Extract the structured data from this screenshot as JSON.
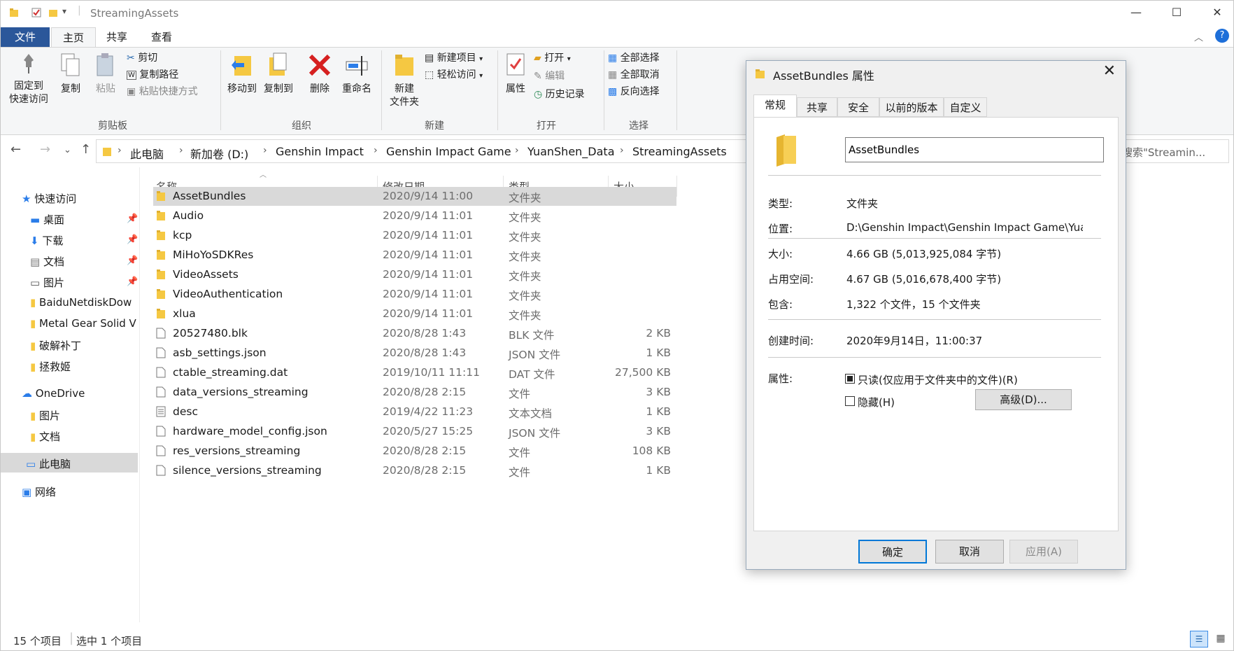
{
  "window": {
    "title": "StreamingAssets",
    "controls": {
      "minimize": "—",
      "maximize": "☐",
      "close": "✕"
    }
  },
  "ribbon_tabs": {
    "file": "文件",
    "home": "主页",
    "share": "共享",
    "view": "查看"
  },
  "ribbon": {
    "clipboard": {
      "pin_l1": "固定到",
      "pin_l2": "快速访问",
      "copy": "复制",
      "paste": "粘贴",
      "cut": "剪切",
      "copy_path": "复制路径",
      "paste_shortcut": "粘贴快捷方式",
      "group": "剪贴板"
    },
    "organize": {
      "move_to": "移动到",
      "copy_to": "复制到",
      "delete": "删除",
      "rename": "重命名",
      "group": "组织"
    },
    "new": {
      "new_folder_l1": "新建",
      "new_folder_l2": "文件夹",
      "new_item": "新建项目",
      "easy_access": "轻松访问",
      "group": "新建"
    },
    "open": {
      "properties": "属性",
      "open": "打开",
      "edit": "编辑",
      "history": "历史记录",
      "group": "打开"
    },
    "select": {
      "select_all": "全部选择",
      "select_none": "全部取消",
      "invert": "反向选择",
      "group": "选择"
    }
  },
  "breadcrumb": [
    "此电脑",
    "新加卷 (D:)",
    "Genshin Impact",
    "Genshin Impact Game",
    "YuanShen_Data",
    "StreamingAssets"
  ],
  "search": {
    "placeholder": "搜索\"Streamin..."
  },
  "nav_pane": {
    "quick_access": "快速访问",
    "items": [
      "桌面",
      "下载",
      "文档",
      "图片",
      "BaiduNetdiskDow",
      "Metal Gear Solid V",
      "破解补丁",
      "拯救姬"
    ],
    "onedrive": "OneDrive",
    "onedrive_items": [
      "图片",
      "文档"
    ],
    "this_pc": "此电脑",
    "network": "网络"
  },
  "columns": {
    "name": "名称",
    "date": "修改日期",
    "type": "类型",
    "size": "大小"
  },
  "files": [
    {
      "name": "AssetBundles",
      "date": "2020/9/14 11:00",
      "type": "文件夹",
      "size": "",
      "kind": "folder"
    },
    {
      "name": "Audio",
      "date": "2020/9/14 11:01",
      "type": "文件夹",
      "size": "",
      "kind": "folder"
    },
    {
      "name": "kcp",
      "date": "2020/9/14 11:01",
      "type": "文件夹",
      "size": "",
      "kind": "folder"
    },
    {
      "name": "MiHoYoSDKRes",
      "date": "2020/9/14 11:01",
      "type": "文件夹",
      "size": "",
      "kind": "folder"
    },
    {
      "name": "VideoAssets",
      "date": "2020/9/14 11:01",
      "type": "文件夹",
      "size": "",
      "kind": "folder"
    },
    {
      "name": "VideoAuthentication",
      "date": "2020/9/14 11:01",
      "type": "文件夹",
      "size": "",
      "kind": "folder"
    },
    {
      "name": "xlua",
      "date": "2020/9/14 11:01",
      "type": "文件夹",
      "size": "",
      "kind": "folder"
    },
    {
      "name": "20527480.blk",
      "date": "2020/8/28 1:43",
      "type": "BLK 文件",
      "size": "2 KB",
      "kind": "file"
    },
    {
      "name": "asb_settings.json",
      "date": "2020/8/28 1:43",
      "type": "JSON 文件",
      "size": "1 KB",
      "kind": "file"
    },
    {
      "name": "ctable_streaming.dat",
      "date": "2019/10/11 11:11",
      "type": "DAT 文件",
      "size": "27,500 KB",
      "kind": "file"
    },
    {
      "name": "data_versions_streaming",
      "date": "2020/8/28 2:15",
      "type": "文件",
      "size": "3 KB",
      "kind": "file"
    },
    {
      "name": "desc",
      "date": "2019/4/22 11:23",
      "type": "文本文档",
      "size": "1 KB",
      "kind": "text"
    },
    {
      "name": "hardware_model_config.json",
      "date": "2020/5/27 15:25",
      "type": "JSON 文件",
      "size": "3 KB",
      "kind": "file"
    },
    {
      "name": "res_versions_streaming",
      "date": "2020/8/28 2:15",
      "type": "文件",
      "size": "108 KB",
      "kind": "file"
    },
    {
      "name": "silence_versions_streaming",
      "date": "2020/8/28 2:15",
      "type": "文件",
      "size": "1 KB",
      "kind": "file"
    }
  ],
  "status": {
    "count": "15 个项目",
    "selected": "选中 1 个项目"
  },
  "dialog": {
    "title": "AssetBundles 属性",
    "tabs": [
      "常规",
      "共享",
      "安全",
      "以前的版本",
      "自定义"
    ],
    "name": "AssetBundles",
    "type_label": "类型:",
    "type_value": "文件夹",
    "location_label": "位置:",
    "location_value": "D:\\Genshin Impact\\Genshin Impact Game\\YuanShen",
    "size_label": "大小:",
    "size_value": "4.66 GB (5,013,925,084 字节)",
    "disk_label": "占用空间:",
    "disk_value": "4.67 GB (5,016,678,400 字节)",
    "contains_label": "包含:",
    "contains_value": "1,322 个文件，15 个文件夹",
    "created_label": "创建时间:",
    "created_value": "2020年9月14日，11:00:37",
    "attr_label": "属性:",
    "readonly": "只读(仅应用于文件夹中的文件)(R)",
    "hidden": "隐藏(H)",
    "advanced": "高级(D)...",
    "ok": "确定",
    "cancel": "取消",
    "apply": "应用(A)"
  }
}
